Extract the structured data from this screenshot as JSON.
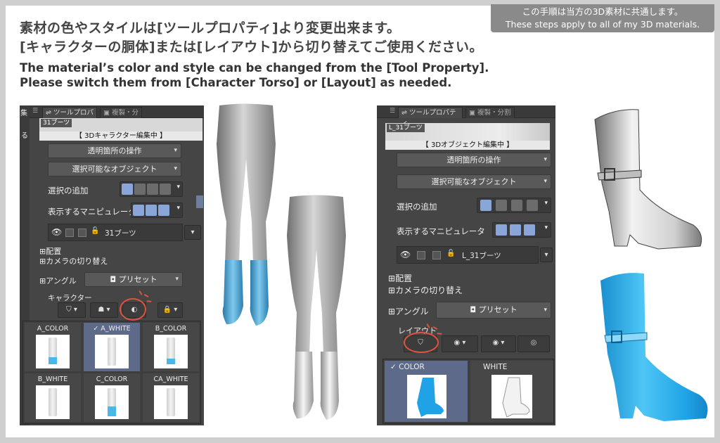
{
  "notice": {
    "jp": "この手順は当方の3D素材に共通します。",
    "en": "These steps apply to all of my 3D materials."
  },
  "heading": {
    "jp_line1": "素材の色やスタイルは[ツールプロパティ]より変更出来ます。",
    "jp_line2": "[キャラクターの胴体]または[レイアウト]から切り替えてご使用ください。",
    "en_line1": "The material’s color and style can be changed from the [Tool Property].",
    "en_line2": "Please switch them from [Character Torso] or [Layout] as needed."
  },
  "left_panel": {
    "side_label_1": "集",
    "side_label_2": "る",
    "tab_active": "ツールプロパティ",
    "tab_inactive": "複製・分割",
    "preview_name": "31ブーツ",
    "preview_mode": "【 3Dキャラクター編集中 】",
    "dropdown_1": "透明箇所の操作",
    "dropdown_2": "選択可能なオブジェクト",
    "row_add_selection": "選択の追加",
    "row_manipulator": "表示するマニピュレータ",
    "layer_name": "31ブーツ",
    "sec_layout": "配置",
    "sec_camera": "カメラの切り替え",
    "angle_label": "アングル",
    "preset_label": "プリセット",
    "character_label": "キャラクター",
    "cells": [
      {
        "label": "A_COLOR",
        "selected": false,
        "color": "#49b8e8"
      },
      {
        "label": "✓ A_WHITE",
        "selected": true,
        "color": "#ffffff"
      },
      {
        "label": "B_COLOR",
        "selected": false,
        "color": "#49b8e8"
      },
      {
        "label": "B_WHITE",
        "selected": false,
        "color": "#ffffff"
      },
      {
        "label": "C_COLOR",
        "selected": false,
        "color": "#49b8e8"
      },
      {
        "label": "CA_WHITE",
        "selected": false,
        "color": "#ffffff"
      }
    ]
  },
  "right_panel": {
    "tab_active": "ツールプロパティ",
    "tab_inactive": "複製・分割",
    "preview_name": "L_31ブーツ",
    "preview_mode": "【 3Dオブジェクト編集中 】",
    "dropdown_1": "透明箇所の操作",
    "dropdown_2": "選択可能なオブジェクト",
    "row_add_selection": "選択の追加",
    "row_manipulator": "表示するマニピュレータ",
    "layer_name": "L_31ブーツ",
    "sec_layout": "配置",
    "sec_camera": "カメラの切り替え",
    "angle_label": "アングル",
    "preset_label": "プリセット",
    "layout_label": "レイアウト",
    "cells": [
      {
        "label": "✓ COLOR",
        "selected": true
      },
      {
        "label": "WHITE",
        "selected": false
      }
    ]
  },
  "colors": {
    "accent_blue": "#1fa3e6",
    "highlight_circle": "#e0533f",
    "panel_bg": "#454545"
  }
}
